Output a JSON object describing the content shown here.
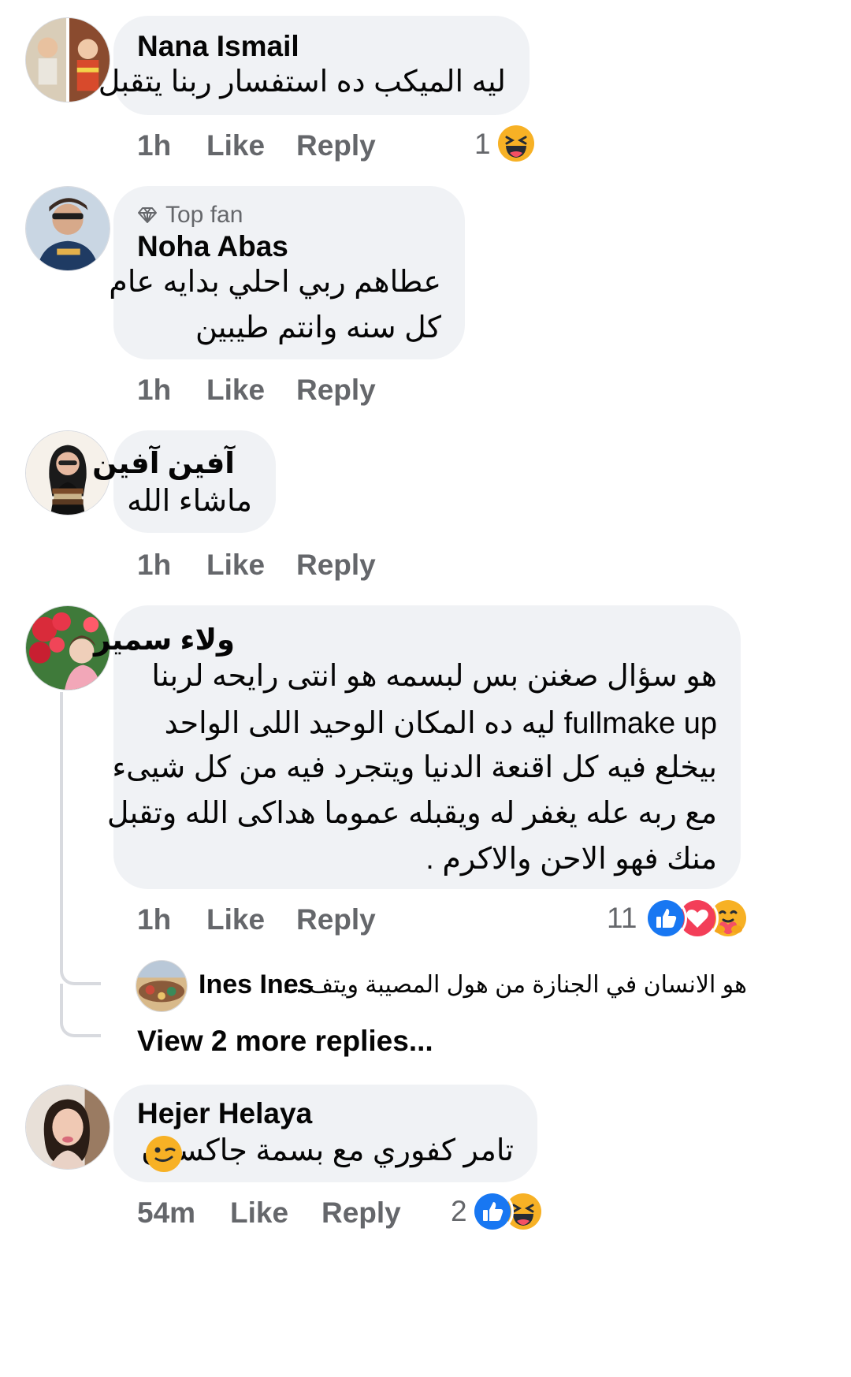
{
  "comments": [
    {
      "author": "Nana Ismail",
      "text_lines": [
        "ليه الميكب ده استفسار ربنا يتقبل"
      ],
      "time": "1h",
      "like_label": "Like",
      "reply_label": "Reply",
      "reaction_count": "1",
      "reactions": [
        "haha-icon"
      ]
    },
    {
      "badge": "Top fan",
      "author": "Noha Abas",
      "text_lines": [
        "عطاهم ربي احلي بدايه عام",
        "كل سنه وانتم طيبين"
      ],
      "time": "1h",
      "like_label": "Like",
      "reply_label": "Reply"
    },
    {
      "author": "آفين آفين",
      "text_lines": [
        "ماشاء الله"
      ],
      "time": "1h",
      "like_label": "Like",
      "reply_label": "Reply"
    },
    {
      "author": "ولاء سمير",
      "text_lines": [
        "هو سؤال صغنن بس لبسمه هو انتى رايحه لربنا",
        "fullmake up ليه ده المكان الوحيد اللى الواحد",
        "بيخلع فيه كل اقنعة الدنيا ويتجرد فيه من كل شيىء",
        "مع ربه عله يغفر له ويقبله عموما هداكى الله وتقبل",
        "منك فهو الاحن والاكرم ."
      ],
      "time": "1h",
      "like_label": "Like",
      "reply_label": "Reply",
      "reaction_count": "11",
      "reactions": [
        "like-icon",
        "love-icon",
        "care-icon"
      ],
      "reply_preview": {
        "author": "Ines Ines",
        "snippet": "هو الانسان في الجنازة من هول المصيبة ويتف ..."
      },
      "view_more": "View 2 more replies..."
    },
    {
      "author": "Hejer Helaya",
      "text_lines": [
        "تامر كفوري مع بسمة جاكسون"
      ],
      "emoji": "wink-icon",
      "time": "54m",
      "like_label": "Like",
      "reply_label": "Reply",
      "reaction_count": "2",
      "reactions": [
        "like-icon",
        "haha-icon"
      ]
    }
  ],
  "colors": {
    "bubble": "#f0f2f5",
    "secondary_text": "#65676b",
    "like_blue": "#1877f2",
    "love_red": "#f33e58",
    "emoji_yellow": "#f7b125"
  }
}
